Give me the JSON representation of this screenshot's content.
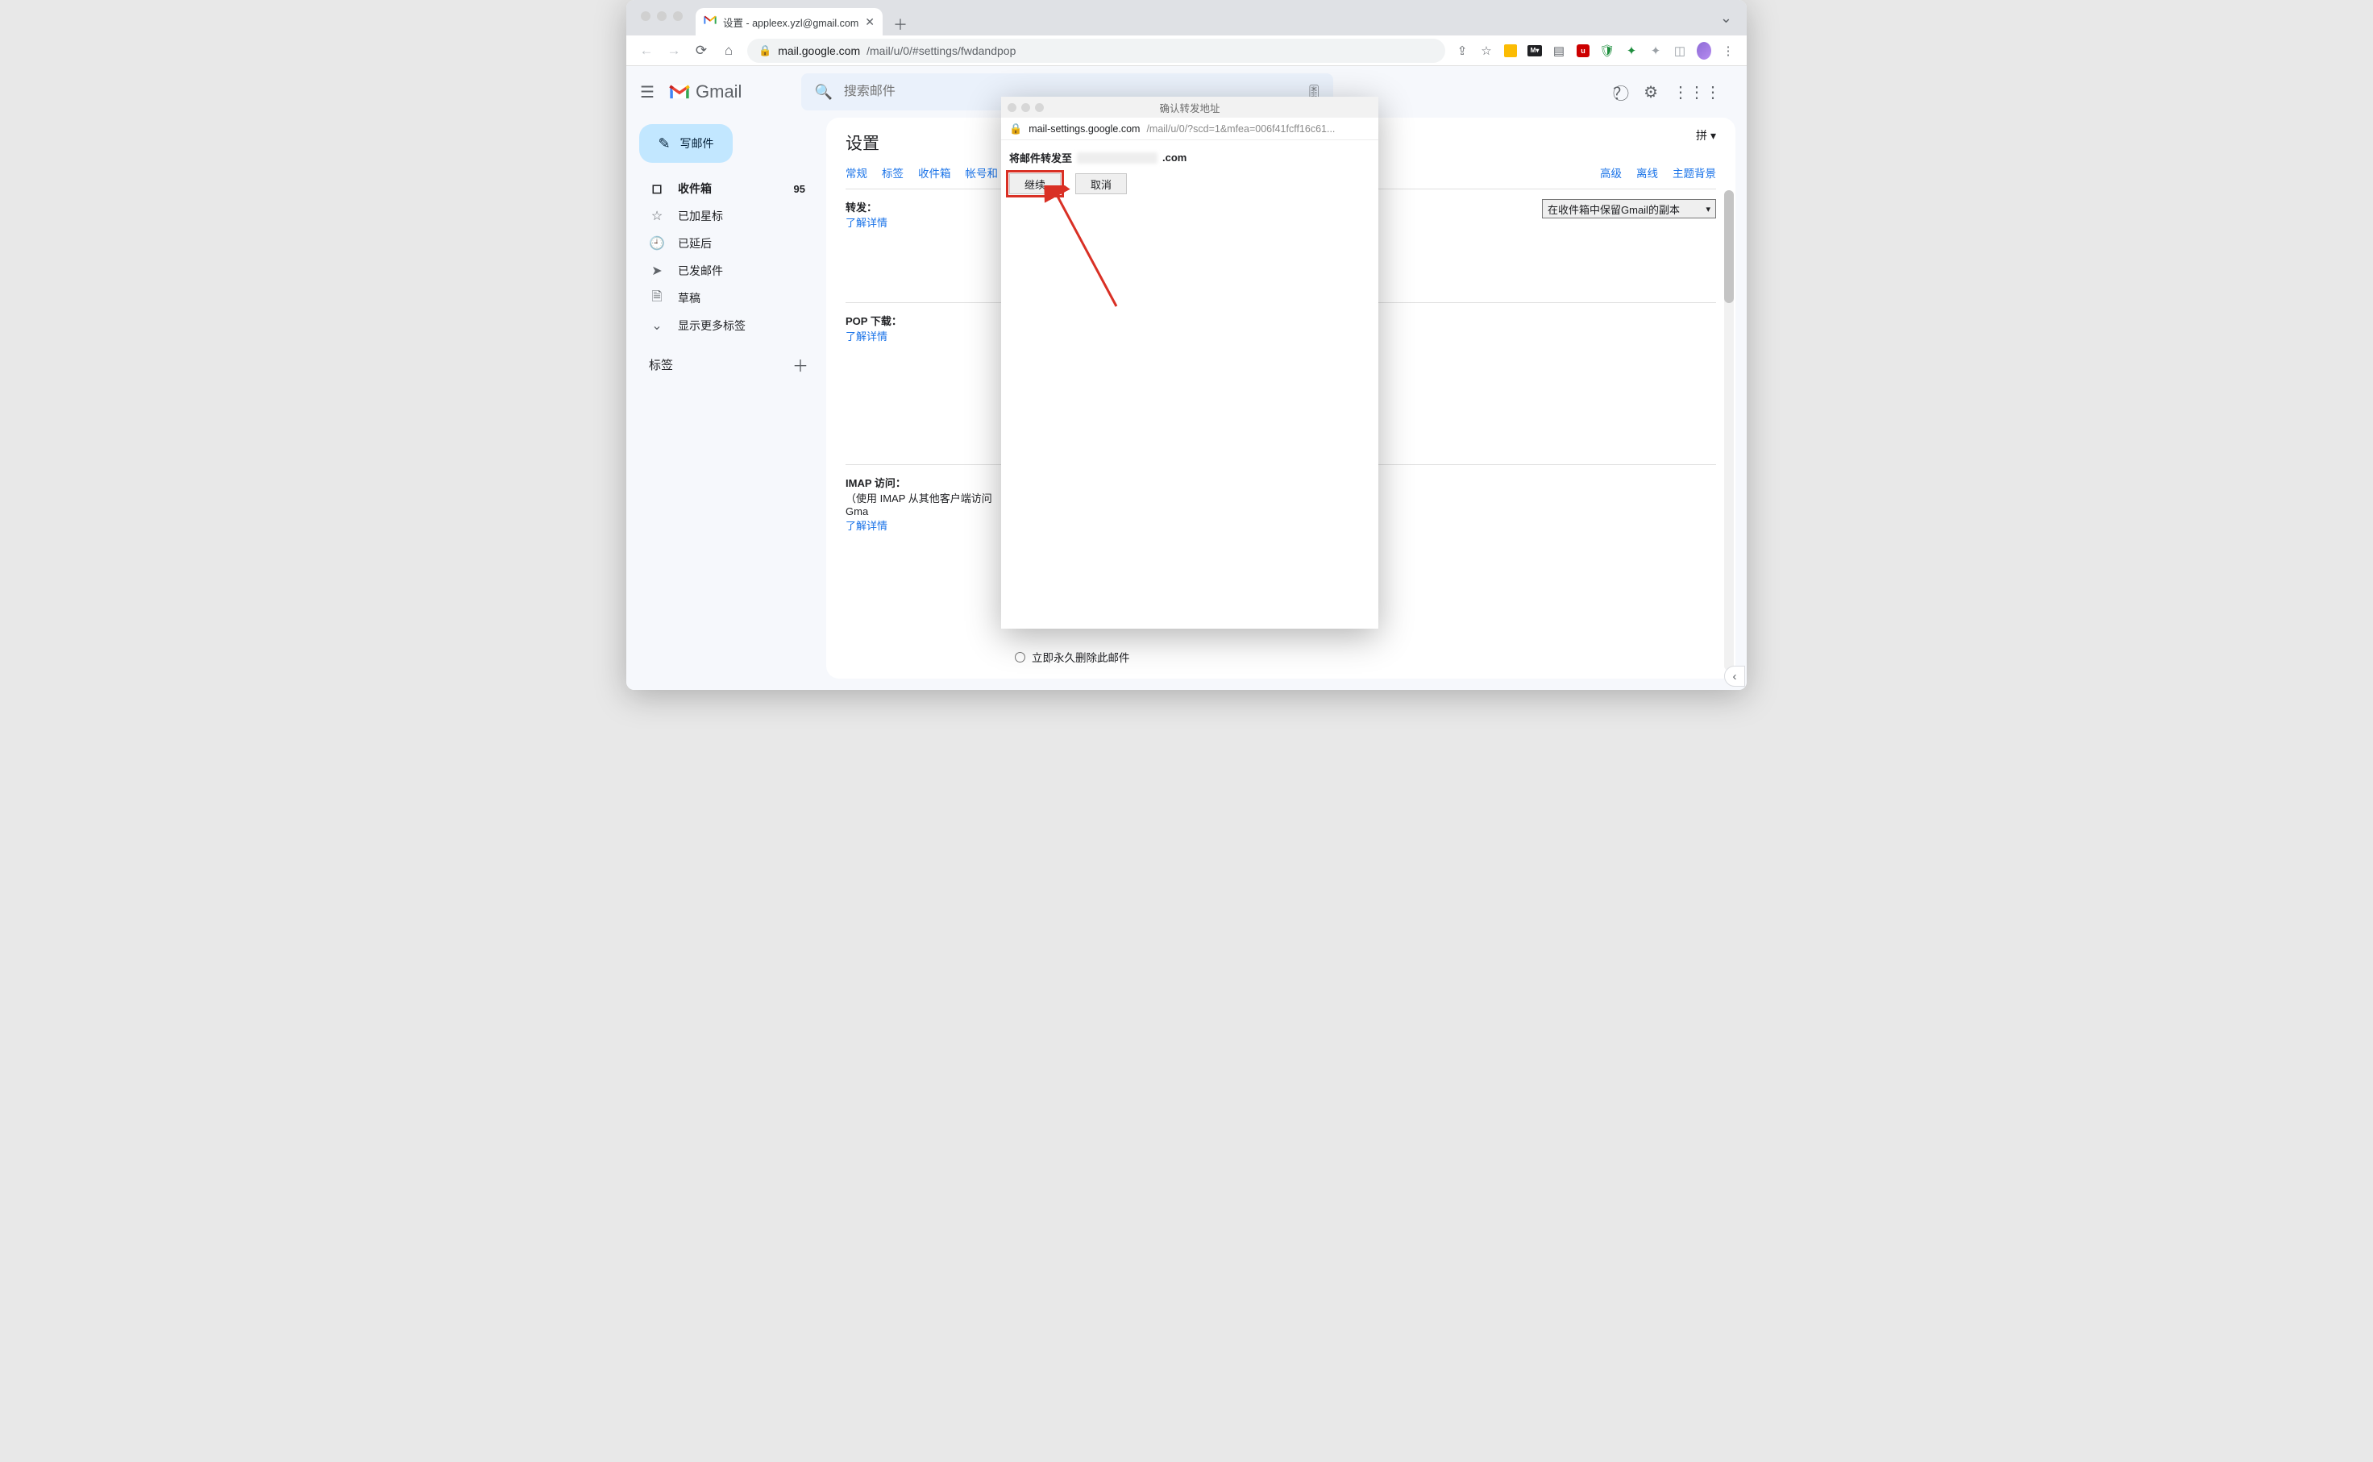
{
  "browser": {
    "tab_title": "设置 - appleex.yzl@gmail.com",
    "url_domain": "mail.google.com",
    "url_path": "/mail/u/0/#settings/fwdandpop"
  },
  "header": {
    "brand": "Gmail",
    "search_placeholder": "搜索邮件"
  },
  "compose_label": "写邮件",
  "nav": {
    "inbox": "收件箱",
    "inbox_count": "95",
    "starred": "已加星标",
    "snoozed": "已延后",
    "sent": "已发邮件",
    "drafts": "草稿",
    "more": "显示更多标签"
  },
  "labels": {
    "header": "标签"
  },
  "page": {
    "title": "设置",
    "input_method": "拼"
  },
  "tabs": {
    "general": "常规",
    "labels": "标签",
    "inbox": "收件箱",
    "accounts": "帐号和",
    "advanced": "高级",
    "offline": "离线",
    "themes": "主题背景"
  },
  "sections": {
    "forwarding": {
      "title": "转发：",
      "learn": "了解详情",
      "keep_option": "在收件箱中保留Gmail的副本"
    },
    "pop": {
      "title": "POP 下载：",
      "learn": "了解详情"
    },
    "imap": {
      "title": "IMAP 访问：",
      "subtitle": "（使用 IMAP 从其他客户端访问 Gma",
      "learn": "了解详情",
      "option_del": "立即永久删除此邮件"
    }
  },
  "popup": {
    "title": "确认转发地址",
    "url_domain": "mail-settings.google.com",
    "url_path": "/mail/u/0/?scd=1&mfea=006f41fcff16c61...",
    "line_prefix": "将邮件转发至",
    "line_suffix": ".com",
    "btn_continue": "继续",
    "btn_cancel": "取消"
  }
}
